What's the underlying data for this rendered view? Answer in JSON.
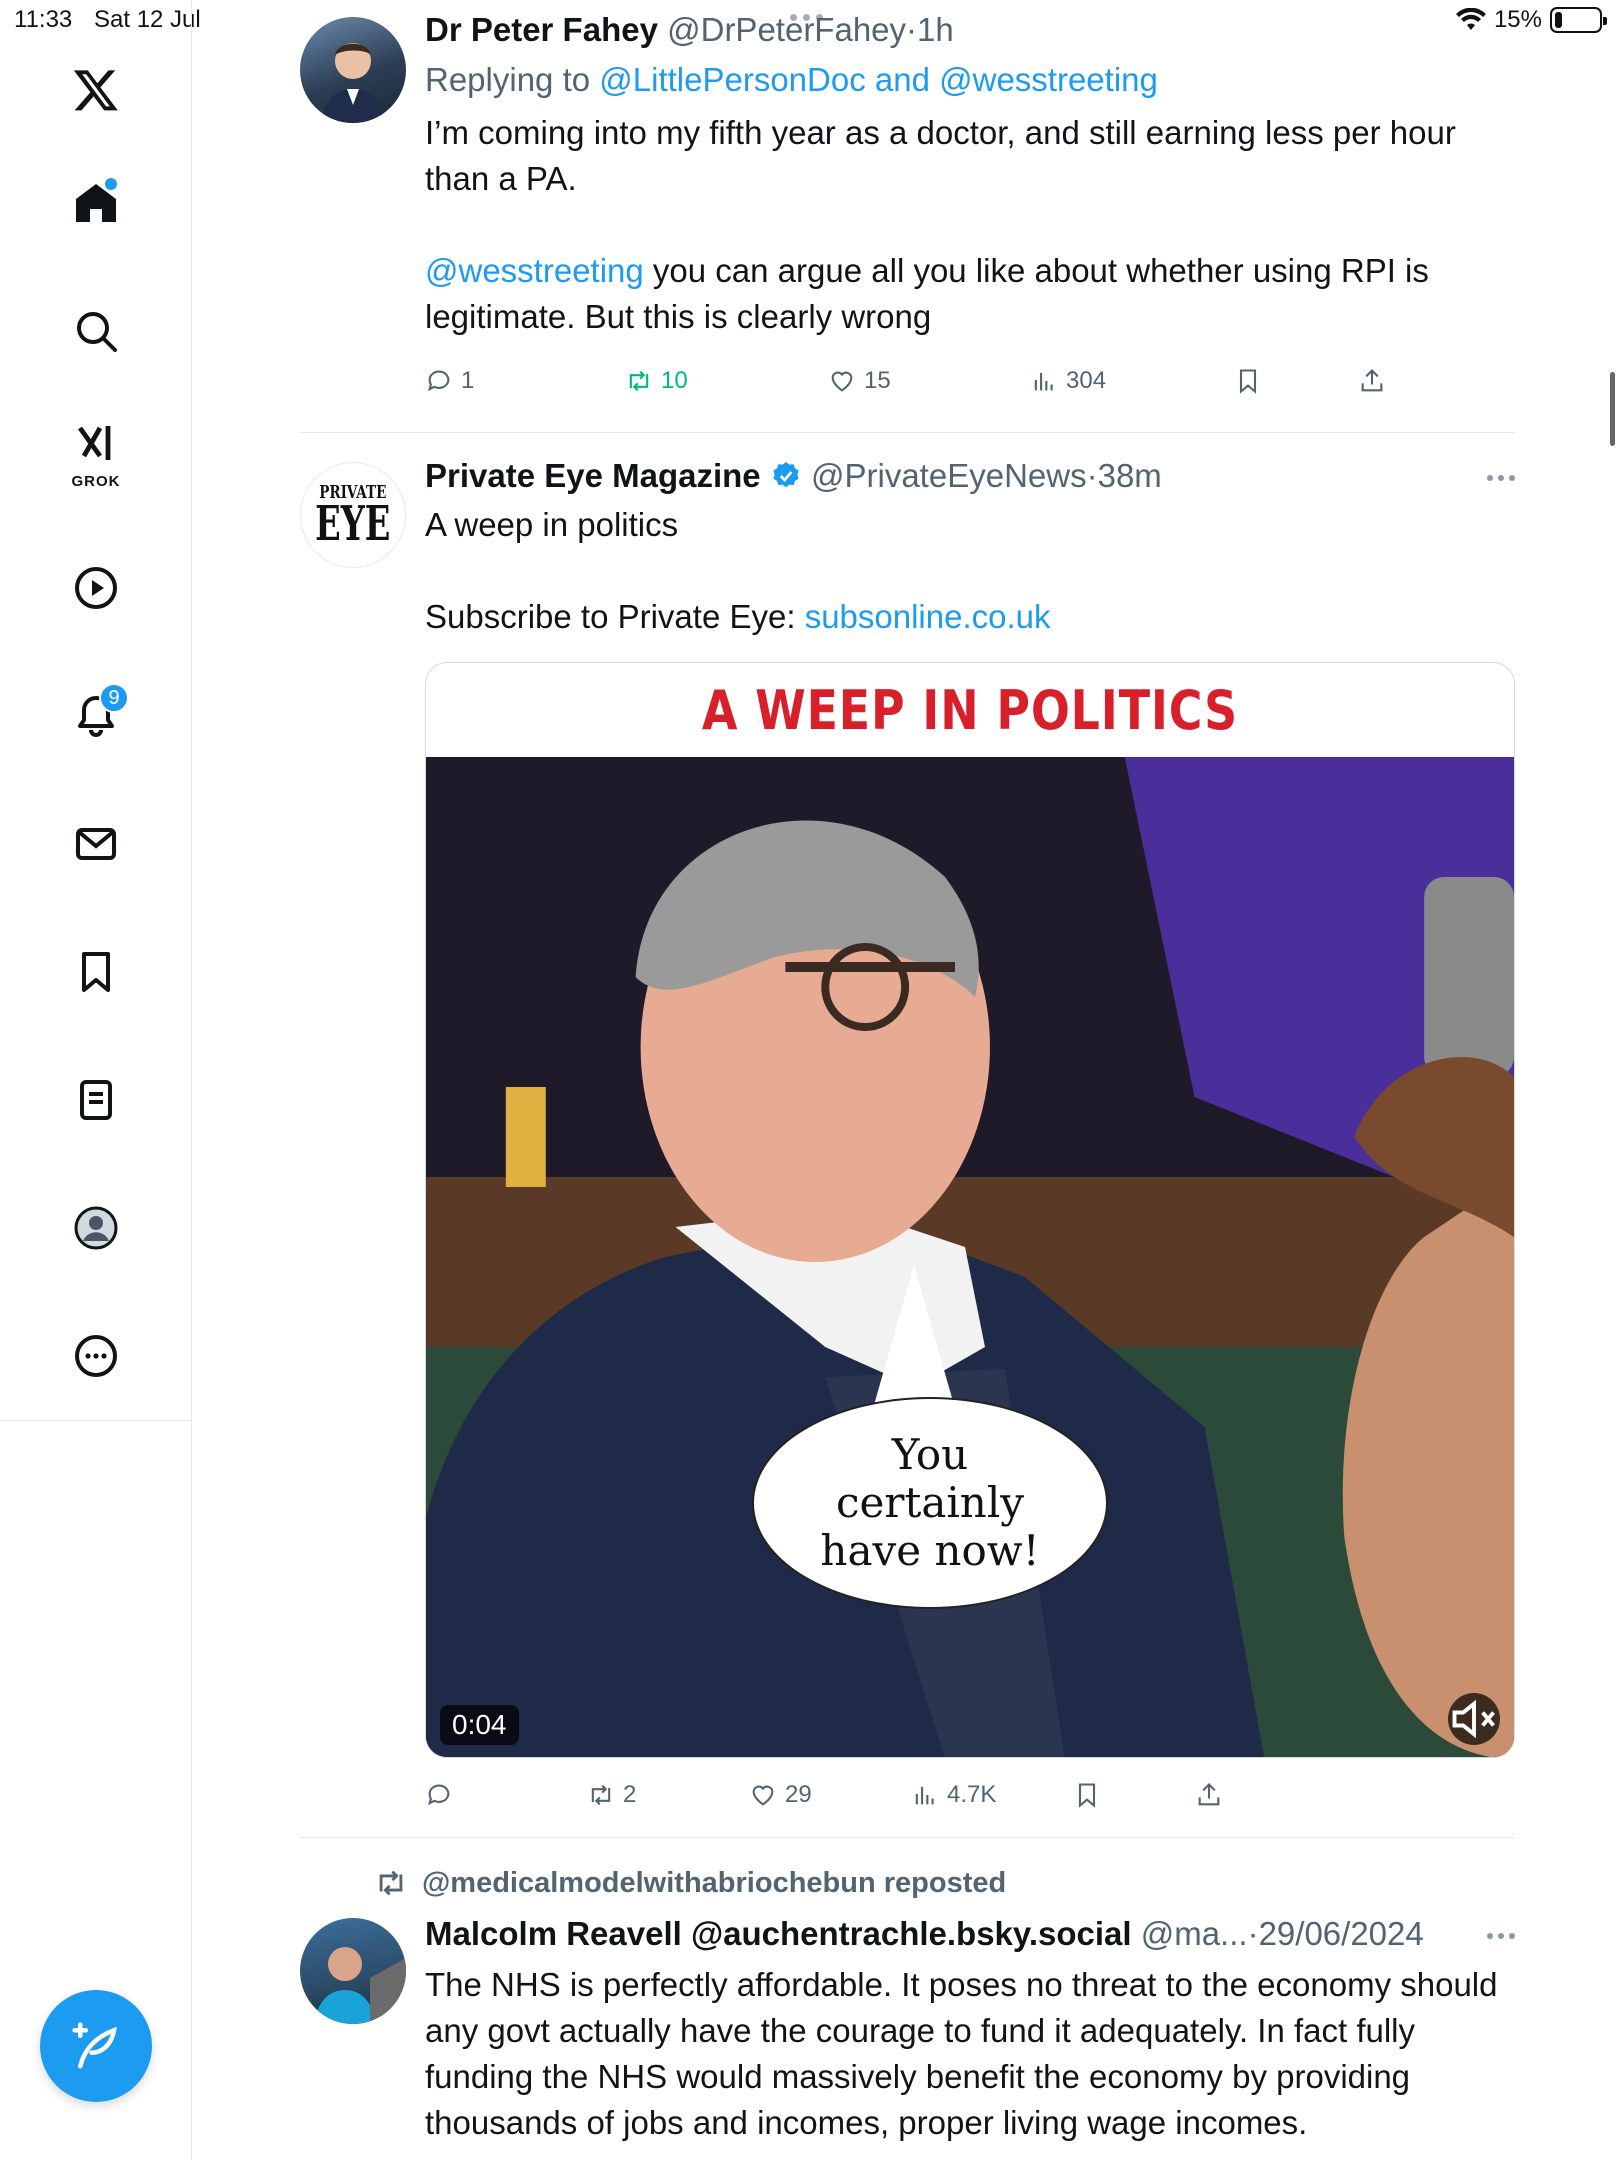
{
  "status_bar": {
    "time": "11:33",
    "date": "Sat 12 Jul",
    "battery": "15%",
    "battery_level": 0.15
  },
  "sidebar": {
    "logo": "x-logo-icon",
    "items": [
      {
        "name": "home",
        "icon": "home-icon",
        "has_dot": true
      },
      {
        "name": "search",
        "icon": "search-icon"
      },
      {
        "name": "grok",
        "icon": "grok-icon",
        "label": "GROK"
      },
      {
        "name": "videos",
        "icon": "play-icon"
      },
      {
        "name": "notifications",
        "icon": "bell-icon",
        "badge": "9"
      },
      {
        "name": "messages",
        "icon": "mail-icon"
      },
      {
        "name": "bookmarks",
        "icon": "bookmark-icon"
      },
      {
        "name": "lists",
        "icon": "list-icon"
      },
      {
        "name": "profile",
        "icon": "profile-icon"
      },
      {
        "name": "more",
        "icon": "more-icon"
      }
    ],
    "compose": "compose-icon"
  },
  "tweets": [
    {
      "name": "Dr Peter Fahey",
      "handle": "@DrPeterFahey",
      "sep": "·",
      "time": "1h",
      "replying_prefix": "Replying to ",
      "replying_to": "@LittlePersonDoc and @wesstreeting",
      "text_1": "I’m coming into my fifth year as a doctor, and still earning less per hour than a PA.",
      "mention": "@wesstreeting",
      "text_2": " you can argue all you like about whether using RPI is legitimate. But this is clearly wrong",
      "replies": "1",
      "reposts": "10",
      "likes": "15",
      "views": "304"
    },
    {
      "name": "Private Eye Magazine",
      "handle": "@PrivateEyeNews",
      "sep": "·",
      "time": "38m",
      "avatar_line1": "PRIVATE",
      "avatar_line2": "EYE",
      "text_1": "A weep in politics",
      "text_2": "Subscribe to Private Eye: ",
      "link": "subsonline.co.uk",
      "media_title": "A WEEP IN POLITICS",
      "bubble_1": "You",
      "bubble_2": "certainly",
      "bubble_3": "have now!",
      "video_time": "0:04",
      "replies": "",
      "reposts": "2",
      "likes": "29",
      "views": "4.7K"
    },
    {
      "repost_by": "@medicalmodelwithabriochebun reposted",
      "name": "Malcolm Reavell @auchentrachle.bsky.social",
      "handle": "@ma...",
      "sep": "·",
      "time": "29/06/2024",
      "text": "The NHS is perfectly affordable. It poses no threat to the economy should any govt actually have the courage to fund it adequately. In fact fully funding the NHS would massively benefit the economy by providing  thousands of jobs and incomes, proper living wage incomes."
    }
  ],
  "colors": {
    "accent": "#1d9bf0",
    "repost_green": "#00ba7c",
    "muted": "#536471",
    "headline_red": "#d8202a"
  }
}
